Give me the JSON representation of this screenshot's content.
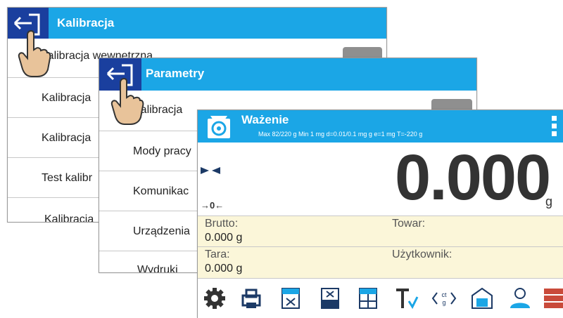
{
  "calib_window": {
    "title": "Kalibracja",
    "items": [
      "Kalibracja wewnętrzna",
      "Kalibracja",
      "Kalibracja",
      "Test kalibr",
      "Kalibracja"
    ]
  },
  "params_window": {
    "title": "Parametry",
    "items": [
      "Kalibracja",
      "Mody pracy",
      "Komunikac",
      "Urządzenia",
      "Wydruki"
    ]
  },
  "weigh_window": {
    "title": "Ważenie",
    "subtitle": "Max 82/220 g  Min 1 mg  d=0.01/0.1 mg g  e=1 mg  T=-220 g",
    "display_value": "0.000",
    "unit": "g",
    "zero_indicator": "→0←",
    "info": {
      "brutto_label": "Brutto:",
      "brutto_value": "0.000 g",
      "tara_label": "Tara:",
      "tara_value": "0.000 g",
      "towar_label": "Towar:",
      "uzytkownik_label": "Użytkownik:"
    },
    "toolbar_icons": [
      "gear-icon",
      "printer-icon",
      "tare-icon",
      "tare-set-icon",
      "tare-select-icon",
      "tare-check-icon",
      "unit-switch-icon",
      "product-icon",
      "user-icon",
      "database-icon"
    ],
    "colors": {
      "titlebar": "#1ba6e6",
      "info_panel": "#fbf6d9",
      "back_button": "#1a3f9e"
    }
  }
}
